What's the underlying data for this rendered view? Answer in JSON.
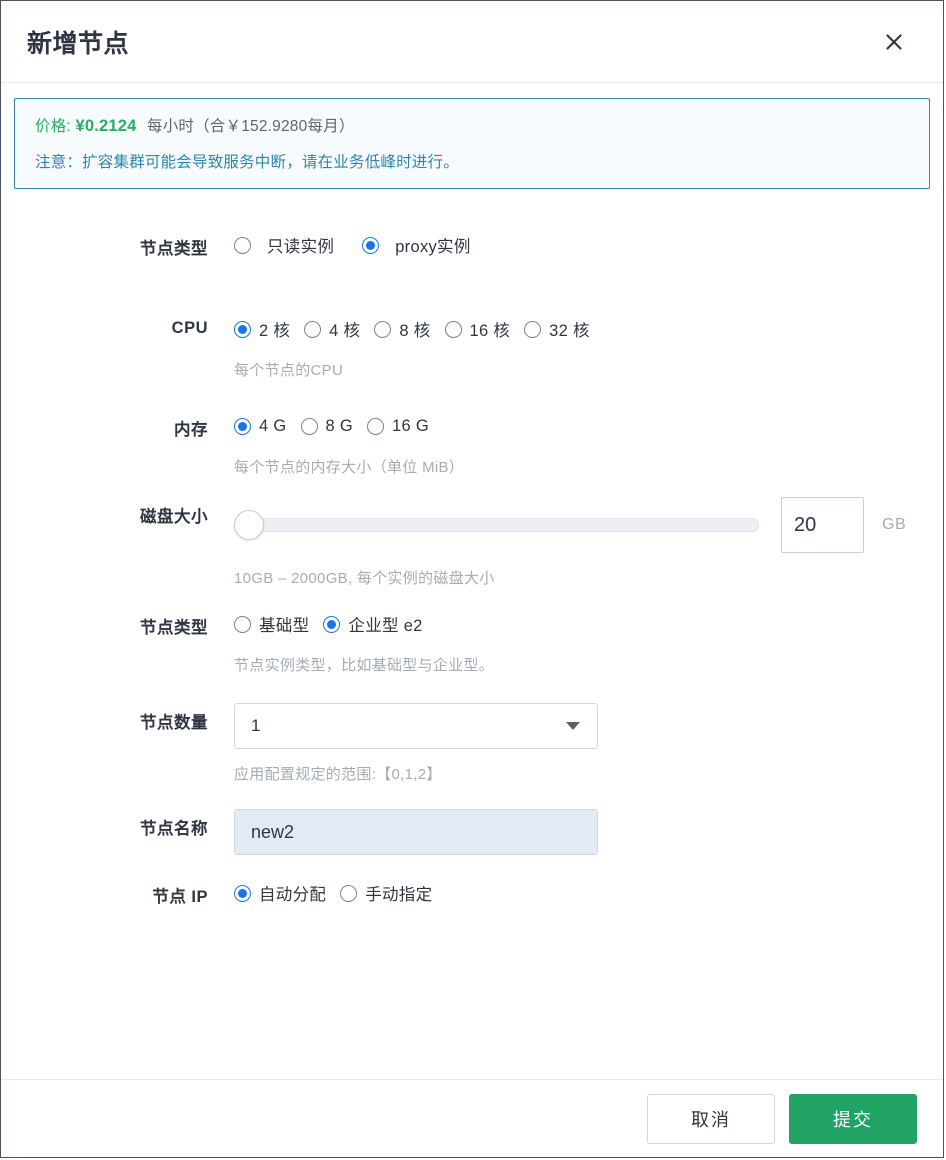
{
  "dialog": {
    "title": "新增节点",
    "close_icon": "close-icon"
  },
  "notice": {
    "price_label": "价格:",
    "price_amount": "¥0.2124",
    "price_per": "每小时（合￥152.9280每月）",
    "warning": "注意：扩容集群可能会导致服务中断，请在业务低峰时进行。",
    "border_color": "#2e86ab",
    "price_color": "#27ae60",
    "warning_color": "#2e86ab"
  },
  "form": {
    "instance_type": {
      "label": "节点类型",
      "options": [
        {
          "label": "只读实例",
          "selected": false
        },
        {
          "label": "proxy实例",
          "selected": true
        }
      ]
    },
    "cpu": {
      "label": "CPU",
      "options": [
        {
          "label": "2 核",
          "selected": true
        },
        {
          "label": "4 核",
          "selected": false
        },
        {
          "label": "8 核",
          "selected": false
        },
        {
          "label": "16 核",
          "selected": false
        },
        {
          "label": "32 核",
          "selected": false
        }
      ],
      "hint": "每个节点的CPU"
    },
    "memory": {
      "label": "内存",
      "options": [
        {
          "label": "4 G",
          "selected": true
        },
        {
          "label": "8 G",
          "selected": false
        },
        {
          "label": "16 G",
          "selected": false
        }
      ],
      "hint": "每个节点的内存大小（单位 MiB）"
    },
    "disk": {
      "label": "磁盘大小",
      "value": "20",
      "unit": "GB",
      "min": 10,
      "max": 2000,
      "hint": "10GB – 2000GB, 每个实例的磁盘大小"
    },
    "node_type": {
      "label": "节点类型",
      "options": [
        {
          "label": "基础型",
          "selected": false
        },
        {
          "label": "企业型 e2",
          "selected": true
        }
      ],
      "hint": "节点实例类型，比如基础型与企业型。"
    },
    "node_count": {
      "label": "节点数量",
      "value": "1",
      "caret_icon": "chevron-down-icon",
      "hint": "应用配置规定的范围:【0,1,2】"
    },
    "node_name": {
      "label": "节点名称",
      "value": "new2"
    },
    "node_ip": {
      "label": "节点 IP",
      "options": [
        {
          "label": "自动分配",
          "selected": true
        },
        {
          "label": "手动指定",
          "selected": false
        }
      ]
    }
  },
  "footer": {
    "cancel_label": "取消",
    "submit_label": "提交",
    "submit_color": "#21a366"
  }
}
